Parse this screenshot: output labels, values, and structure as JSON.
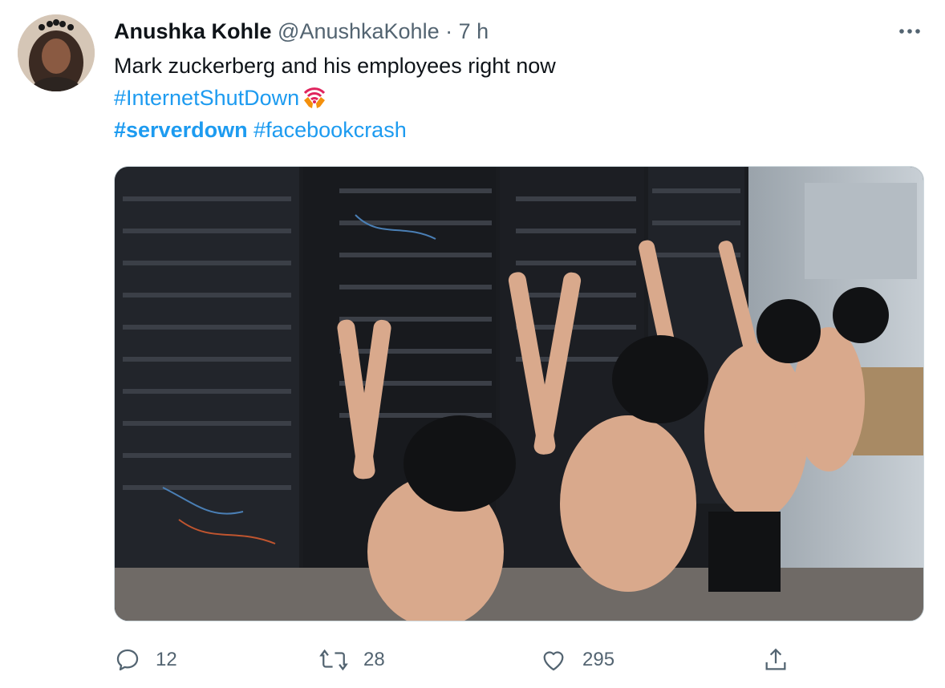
{
  "tweet": {
    "display_name": "Anushka Kohle",
    "handle": "@AnushkaKohle",
    "separator": "·",
    "time": "7 h",
    "text_line1": "Mark zuckerberg and his employees right now",
    "hashtags": [
      "#InternetShutDown",
      "#serverdown",
      "#facebookcrash"
    ],
    "emoji": "wifi-praying-hands-emoji",
    "media_alt": "Photo of shirtless men kneeling and praying in front of server racks"
  },
  "actions": {
    "reply_count": "12",
    "retweet_count": "28",
    "like_count": "295"
  },
  "icons": [
    "more-icon",
    "reply-icon",
    "retweet-icon",
    "like-icon",
    "share-icon"
  ],
  "colors": {
    "link": "#1d9bf0",
    "muted": "#536471",
    "text": "#0f1419"
  }
}
